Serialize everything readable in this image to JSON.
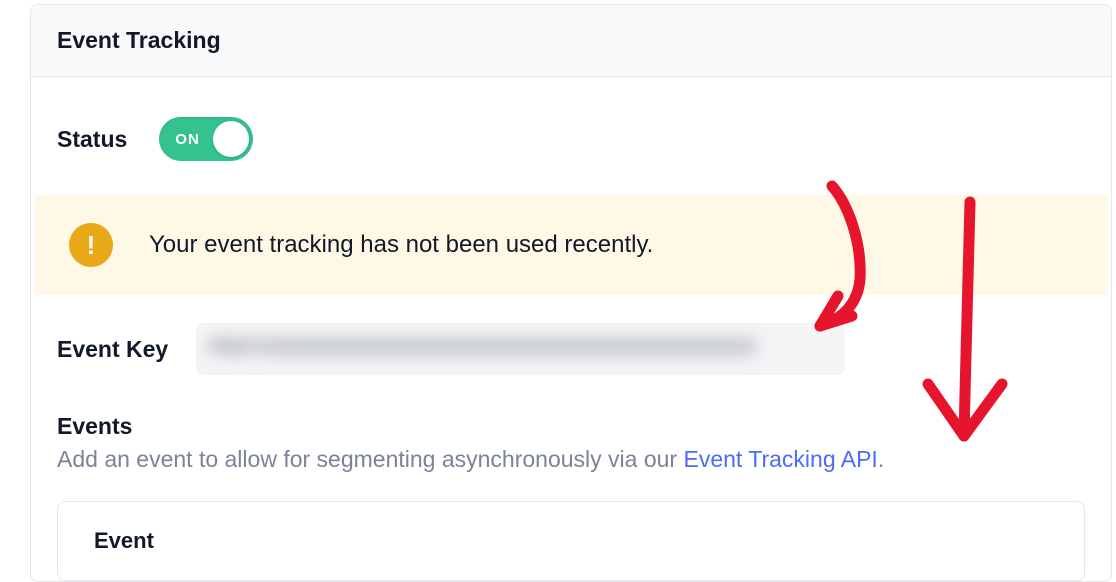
{
  "panel": {
    "title": "Event Tracking"
  },
  "status": {
    "label": "Status",
    "toggle_state": "ON"
  },
  "alert": {
    "icon": "!",
    "message": "Your event tracking has not been used recently."
  },
  "event_key": {
    "label": "Event Key"
  },
  "events": {
    "heading": "Events",
    "desc_prefix": "Add an event to allow for segmenting asynchronously via our ",
    "link_text": "Event Tracking API",
    "desc_suffix": "."
  },
  "table": {
    "col_event": "Event"
  }
}
